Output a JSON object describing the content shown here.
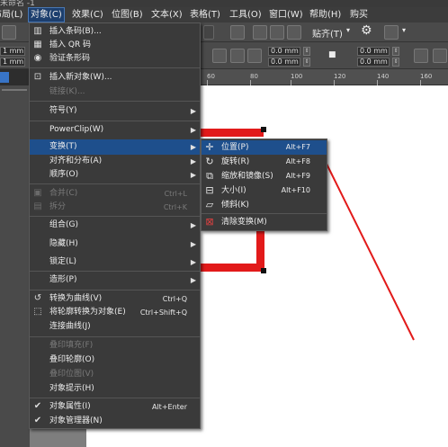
{
  "title_strip": "未命名 -1",
  "menubar": {
    "items": [
      {
        "label": "布局(L)",
        "active": false
      },
      {
        "label": "对象(C)",
        "active": true
      },
      {
        "label": "效果(C)",
        "active": false
      },
      {
        "label": "位图(B)",
        "active": false
      },
      {
        "label": "文本(X)",
        "active": false
      },
      {
        "label": "表格(T)",
        "active": false
      },
      {
        "label": "工具(O)",
        "active": false
      },
      {
        "label": "窗口(W)",
        "active": false
      },
      {
        "label": "帮助(H)",
        "active": false
      },
      {
        "label": "购买",
        "active": false
      }
    ]
  },
  "toolbar": {
    "paste_label": "贴齐(T)",
    "field_values": [
      "0.0 mm",
      "0.0 mm",
      "0.0 mm",
      "0.0 mm"
    ],
    "left_values": [
      "1 mm",
      "1 mm"
    ]
  },
  "ruler": {
    "ticks": [
      "60",
      "80",
      "100",
      "120",
      "140",
      "160"
    ]
  },
  "object_menu": {
    "items": [
      {
        "label": "插入条码(B)...",
        "shortcut": "",
        "submenu": false,
        "disabled": false,
        "icon": "barcode-icon",
        "glyph": "▥"
      },
      {
        "label": "插入 QR 码",
        "shortcut": "",
        "submenu": false,
        "disabled": false,
        "icon": "qr-code-icon",
        "glyph": "▦"
      },
      {
        "label": "验证条形码",
        "shortcut": "",
        "submenu": false,
        "disabled": false,
        "icon": "validate-barcode-icon",
        "glyph": "◉"
      },
      {
        "label": "插入新对象(W)...",
        "shortcut": "",
        "submenu": false,
        "disabled": false,
        "icon": "new-object-icon",
        "glyph": "⊡"
      },
      {
        "label": "链接(K)...",
        "shortcut": "",
        "submenu": false,
        "disabled": true,
        "icon": "",
        "glyph": ""
      },
      {
        "label": "符号(Y)",
        "shortcut": "",
        "submenu": true,
        "disabled": false,
        "icon": "",
        "glyph": ""
      },
      {
        "label": "PowerClip(W)",
        "shortcut": "",
        "submenu": true,
        "disabled": false,
        "icon": "",
        "glyph": ""
      },
      {
        "label": "变换(T)",
        "shortcut": "",
        "submenu": true,
        "disabled": false,
        "icon": "",
        "glyph": "",
        "highlight": true
      },
      {
        "label": "对齐和分布(A)",
        "shortcut": "",
        "submenu": true,
        "disabled": false,
        "icon": "",
        "glyph": ""
      },
      {
        "label": "顺序(O)",
        "shortcut": "",
        "submenu": true,
        "disabled": false,
        "icon": "",
        "glyph": ""
      },
      {
        "label": "合并(C)",
        "shortcut": "Ctrl+L",
        "submenu": false,
        "disabled": true,
        "icon": "combine-icon",
        "glyph": "▣"
      },
      {
        "label": "拆分",
        "shortcut": "Ctrl+K",
        "submenu": false,
        "disabled": true,
        "icon": "break-apart-icon",
        "glyph": "▤"
      },
      {
        "label": "组合(G)",
        "shortcut": "",
        "submenu": true,
        "disabled": false,
        "icon": "",
        "glyph": ""
      },
      {
        "label": "隐藏(H)",
        "shortcut": "",
        "submenu": true,
        "disabled": false,
        "icon": "",
        "glyph": ""
      },
      {
        "label": "锁定(L)",
        "shortcut": "",
        "submenu": true,
        "disabled": false,
        "icon": "",
        "glyph": ""
      },
      {
        "label": "造形(P)",
        "shortcut": "",
        "submenu": true,
        "disabled": false,
        "icon": "",
        "glyph": ""
      },
      {
        "label": "转换为曲线(V)",
        "shortcut": "Ctrl+Q",
        "submenu": false,
        "disabled": false,
        "icon": "convert-to-curves-icon",
        "glyph": "↺"
      },
      {
        "label": "将轮廓转换为对象(E)",
        "shortcut": "Ctrl+Shift+Q",
        "submenu": false,
        "disabled": false,
        "icon": "outline-to-object-icon",
        "glyph": "⬚"
      },
      {
        "label": "连接曲线(J)",
        "shortcut": "",
        "submenu": false,
        "disabled": false,
        "icon": "",
        "glyph": ""
      },
      {
        "label": "叠印填充(F)",
        "shortcut": "",
        "submenu": false,
        "disabled": true,
        "icon": "",
        "glyph": ""
      },
      {
        "label": "叠印轮廓(O)",
        "shortcut": "",
        "submenu": false,
        "disabled": false,
        "icon": "",
        "glyph": ""
      },
      {
        "label": "叠印位图(V)",
        "shortcut": "",
        "submenu": false,
        "disabled": true,
        "icon": "",
        "glyph": ""
      },
      {
        "label": "对象提示(H)",
        "shortcut": "",
        "submenu": false,
        "disabled": false,
        "icon": "",
        "glyph": ""
      },
      {
        "label": "对象属性(I)",
        "shortcut": "Alt+Enter",
        "submenu": false,
        "disabled": false,
        "icon": "check-icon",
        "glyph": "✔"
      },
      {
        "label": "对象管理器(N)",
        "shortcut": "",
        "submenu": false,
        "disabled": false,
        "icon": "check-icon",
        "glyph": "✔"
      }
    ]
  },
  "transform_submenu": {
    "items": [
      {
        "label": "位置(P)",
        "shortcut": "Alt+F7",
        "icon": "position-icon",
        "glyph": "✛",
        "highlight": true
      },
      {
        "label": "旋转(R)",
        "shortcut": "Alt+F8",
        "icon": "rotate-icon",
        "glyph": "↻"
      },
      {
        "label": "缩放和镜像(S)",
        "shortcut": "Alt+F9",
        "icon": "scale-mirror-icon",
        "glyph": "⧉"
      },
      {
        "label": "大小(I)",
        "shortcut": "Alt+F10",
        "icon": "size-icon",
        "glyph": "⊟"
      },
      {
        "label": "倾斜(K)",
        "shortcut": "",
        "icon": "skew-icon",
        "glyph": "▱"
      },
      {
        "label": "清除变换(M)",
        "shortcut": "",
        "icon": "clear-transform-icon",
        "glyph": "⊠"
      }
    ]
  },
  "colors": {
    "menu_bg": "#3a3a3a",
    "highlight": "#1e4f8c",
    "annotation_red": "#e21a1a"
  }
}
